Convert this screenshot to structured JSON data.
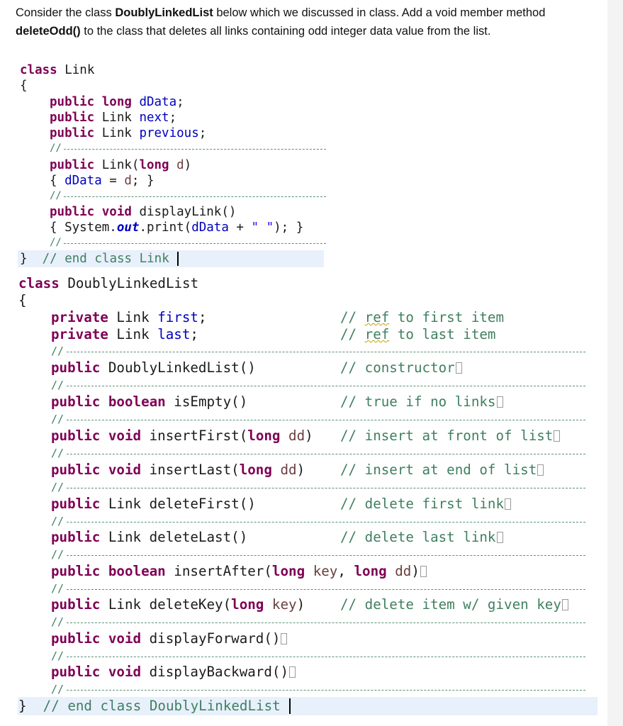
{
  "question": {
    "p1": "Consider the class ",
    "p2": "DoublyLinkedList",
    "p3": " below which we discussed in class. Add a void member method ",
    "p4": "deleteOdd()",
    "p5": " to the class that deletes all links containing odd integer data value from the list."
  },
  "link_class": {
    "l1_kw": "class",
    "l1_name": " Link",
    "l2": "{",
    "f1_kw": "public long",
    "f1_name": "dData",
    "f2_kw": "public",
    "f2_type": " Link ",
    "f2_name": "next",
    "f3_kw": "public",
    "f3_type": " Link ",
    "f3_name": "previous",
    "sep": "//",
    "c1_kw": "public",
    "c1_name": " Link(",
    "c1_kw2": "long",
    "c1_param": " d",
    "c2_open": "{ ",
    "c2_field": "dData",
    "c2_eq": " = ",
    "c2_param": "d",
    "c2_close": "; }",
    "d1_kw": "public void",
    "d1_name": " displayLink()",
    "d2_open": "{ System.",
    "d2_out": "out",
    "d2_call": ".print(",
    "d2_field": "dData",
    "d2_plus": " + ",
    "d2_str": "\" \"",
    "d2_close": "); }",
    "end_brace": "}",
    "end_comment": "// end class Link"
  },
  "dll_class": {
    "l1_kw": "class",
    "l1_name": " DoublyLinkedList",
    "l2": "{",
    "first_kw": "private",
    "first_type": " Link ",
    "first_name": "first",
    "first_comment_a": "// ",
    "first_comment_ref": "ref",
    "first_comment_b": " to first item",
    "last_kw": "private",
    "last_type": " Link ",
    "last_name": "last",
    "last_comment_a": "// ",
    "last_comment_ref": "ref",
    "last_comment_b": " to last item",
    "m_ctor_kw": "public",
    "m_ctor_sig": " DoublyLinkedList()",
    "m_ctor_cm": "// constructor",
    "m_empty_kw": "public boolean",
    "m_empty_sig": " isEmpty()",
    "m_empty_cm": "// true if no links",
    "m_if_kw": "public void",
    "m_if_sig1": " insertFirst(",
    "m_if_kw2": "long",
    "m_if_prm": " dd",
    "m_if_sig2": ")",
    "m_if_cm": "// insert at front of list",
    "m_il_kw": "public void",
    "m_il_sig1": " insertLast(",
    "m_il_kw2": "long",
    "m_il_prm": " dd",
    "m_il_sig2": ")",
    "m_il_cm": "// insert at end of list",
    "m_df_kw": "public",
    "m_df_sig": " Link deleteFirst()",
    "m_df_cm": "// delete first link",
    "m_dl_kw": "public",
    "m_dl_sig": " Link deleteLast()",
    "m_dl_cm": "// delete last link",
    "m_ia_kw": "public boolean",
    "m_ia_sig1": " insertAfter(",
    "m_ia_kw2": "long",
    "m_ia_prm1": " key",
    "m_ia_sep": ", ",
    "m_ia_kw3": "long",
    "m_ia_prm2": " dd",
    "m_ia_sig2": ")",
    "m_dk_kw": "public",
    "m_dk_sig1": " Link deleteKey(",
    "m_dk_kw2": "long",
    "m_dk_prm": " key",
    "m_dk_sig2": ")",
    "m_dk_cm": "// delete item w/ given key",
    "m_dfw_kw": "public void",
    "m_dfw_sig": " displayForward()",
    "m_dbw_kw": "public void",
    "m_dbw_sig": " displayBackward()",
    "sep": "//",
    "end_brace": "}",
    "end_comment": "// end class DoublyLinkedList"
  }
}
